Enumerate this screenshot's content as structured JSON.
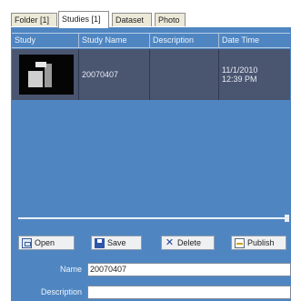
{
  "tabs": [
    {
      "label": "Folder [1]",
      "active": false
    },
    {
      "label": "Studies [1]",
      "active": true
    },
    {
      "label": "Dataset",
      "active": false
    },
    {
      "label": "Photo",
      "active": false
    }
  ],
  "table": {
    "columns": [
      "Study",
      "Study Name",
      "Description",
      "Date Time"
    ],
    "rows": [
      {
        "study_name": "20070407",
        "description": "",
        "date_line1": "11/1/2010",
        "date_line2": "12:39 PM",
        "thumbnail_icon": "study-thumbnail-image"
      }
    ]
  },
  "slider": {
    "value": 1.0
  },
  "buttons": {
    "open": {
      "label": "Open",
      "icon": "folder-open-icon"
    },
    "save": {
      "label": "Save",
      "icon": "floppy-disk-icon"
    },
    "delete": {
      "label": "Delete",
      "icon": "x-delete-icon"
    },
    "publish": {
      "label": "Publish",
      "icon": "publish-icon"
    }
  },
  "form": {
    "name_label": "Name",
    "name_value": "20070407",
    "description_label": "Description",
    "description_value": ""
  },
  "colors": {
    "panel_bg": "#4f86c2",
    "selected_row_bg": "#4a5570"
  }
}
